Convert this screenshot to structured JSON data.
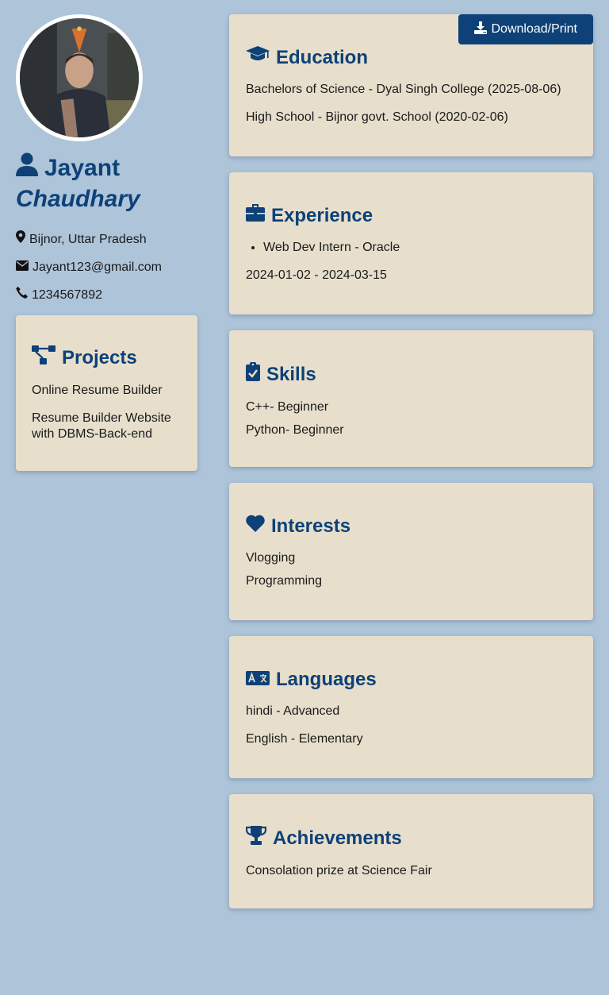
{
  "profile": {
    "first_name": "Jayant",
    "last_name": "Chaudhary",
    "location": "Bijnor, Uttar Pradesh",
    "email": "Jayant123@gmail.com",
    "phone": "1234567892"
  },
  "actions": {
    "download_label": "Download/Print"
  },
  "projects": {
    "title": "Projects",
    "items": [
      "Online Resume Builder",
      "Resume Builder Website with DBMS-Back-end"
    ]
  },
  "education": {
    "title": "Education",
    "items": [
      "Bachelors of Science - Dyal Singh College (2025-08-06)",
      "High School - Bijnor govt. School (2020-02-06)"
    ]
  },
  "experience": {
    "title": "Experience",
    "role": "Web Dev Intern - Oracle",
    "dates": "2024-01-02 - 2024-03-15"
  },
  "skills": {
    "title": "Skills",
    "items": [
      "C++- Beginner",
      "Python- Beginner"
    ]
  },
  "interests": {
    "title": "Interests",
    "items": [
      "Vlogging",
      "Programming"
    ]
  },
  "languages": {
    "title": "Languages",
    "items": [
      "hindi - Advanced",
      "English - Elementary"
    ]
  },
  "achievements": {
    "title": "Achievements",
    "items": [
      "Consolation prize at Science Fair"
    ]
  },
  "colors": {
    "background": "#aec4d9",
    "card": "#e7dfcc",
    "accent": "#0d4178"
  },
  "icons": {
    "user": "user-icon",
    "location": "map-marker-icon",
    "email": "envelope-icon",
    "phone": "phone-icon",
    "projects": "diagram-project-icon",
    "education": "graduation-cap-icon",
    "experience": "briefcase-icon",
    "skills": "clipboard-check-icon",
    "interests": "heart-icon",
    "languages": "language-icon",
    "achievements": "trophy-icon",
    "download": "download-icon"
  }
}
